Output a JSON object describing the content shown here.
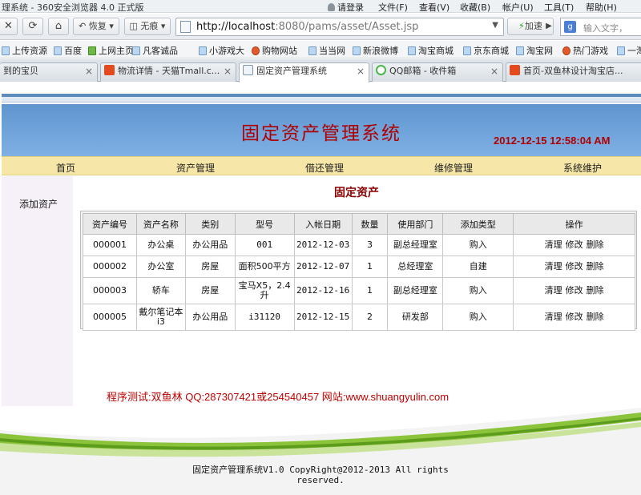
{
  "browser": {
    "window_title": "理系统 - 360安全浏览器 4.0 正式版",
    "menu": {
      "login": "请登录",
      "file": "文件(F)",
      "view": "查看(V)",
      "favorites": "收藏(B)",
      "account": "帐户(U)",
      "tools": "工具(T)",
      "help": "帮助(H)"
    },
    "nav": {
      "restore_label": "恢复",
      "trace_label": "无痕",
      "url_host": "http://localhost",
      "url_rest": ":8080/pams/asset/Asset.jsp",
      "accelerate_label": "加速",
      "search_placeholder": "输入文字，"
    },
    "bookmarks": [
      "上传资源",
      "百度",
      "上网主页",
      "凡客诚品",
      "小游戏大",
      "购物网站",
      "当当网",
      "新浪微博",
      "淘宝商城",
      "京东商城",
      "淘宝网",
      "热门游戏",
      "一淘"
    ],
    "tabs": [
      {
        "label": "到的宝贝"
      },
      {
        "label": "物流详情 - 天猫Tmall.c..."
      },
      {
        "label": "固定资产管理系统"
      },
      {
        "label": "QQ邮箱 - 收件箱"
      },
      {
        "label": "首页-双鱼林设计淘宝店..."
      }
    ]
  },
  "site": {
    "title": "固定资产管理系统",
    "clock": "2012-12-15 12:58:04 AM",
    "nav": [
      "首页",
      "资产管理",
      "借还管理",
      "维修管理",
      "系统维护"
    ],
    "sidebar": [
      "添加资产"
    ],
    "page_title": "固定资产",
    "table": {
      "headers": [
        "资产编号",
        "资产名称",
        "类别",
        "型号",
        "入帐日期",
        "数量",
        "使用部门",
        "添加类型",
        "操作"
      ],
      "rows": [
        [
          "000001",
          "办公桌",
          "办公用品",
          "001",
          "2012-12-03",
          "3",
          "副总经理室",
          "购入"
        ],
        [
          "000002",
          "办公室",
          "房屋",
          "面积500平方",
          "2012-12-07",
          "1",
          "总经理室",
          "自建"
        ],
        [
          "000003",
          "轿车",
          "房屋",
          "宝马X5，2.4升",
          "2012-12-16",
          "1",
          "副总经理室",
          "购入"
        ],
        [
          "000005",
          "戴尔笔记本i3",
          "办公用品",
          "i31120",
          "2012-12-15",
          "2",
          "研发部",
          "购入"
        ]
      ],
      "actions": [
        "清理",
        "修改",
        "删除"
      ]
    },
    "credits": "程序测试:双鱼林 QQ:287307421或254540457 网站:www.shuangyulin.com",
    "footer_line1": "固定资产管理系统V1.0 CopyRight@2012-2013 All rights",
    "footer_line2": "reserved."
  },
  "colors": {
    "banner": "#6a9fd8",
    "title_red": "#b00000",
    "nav_yellow": "#f6e7a8",
    "sidebar_bg": "#f6f1f8",
    "footer_green": "#7cb928"
  },
  "icons": [
    "close-icon",
    "refresh-icon",
    "home-icon",
    "page-icon",
    "google-icon",
    "user-icon"
  ]
}
